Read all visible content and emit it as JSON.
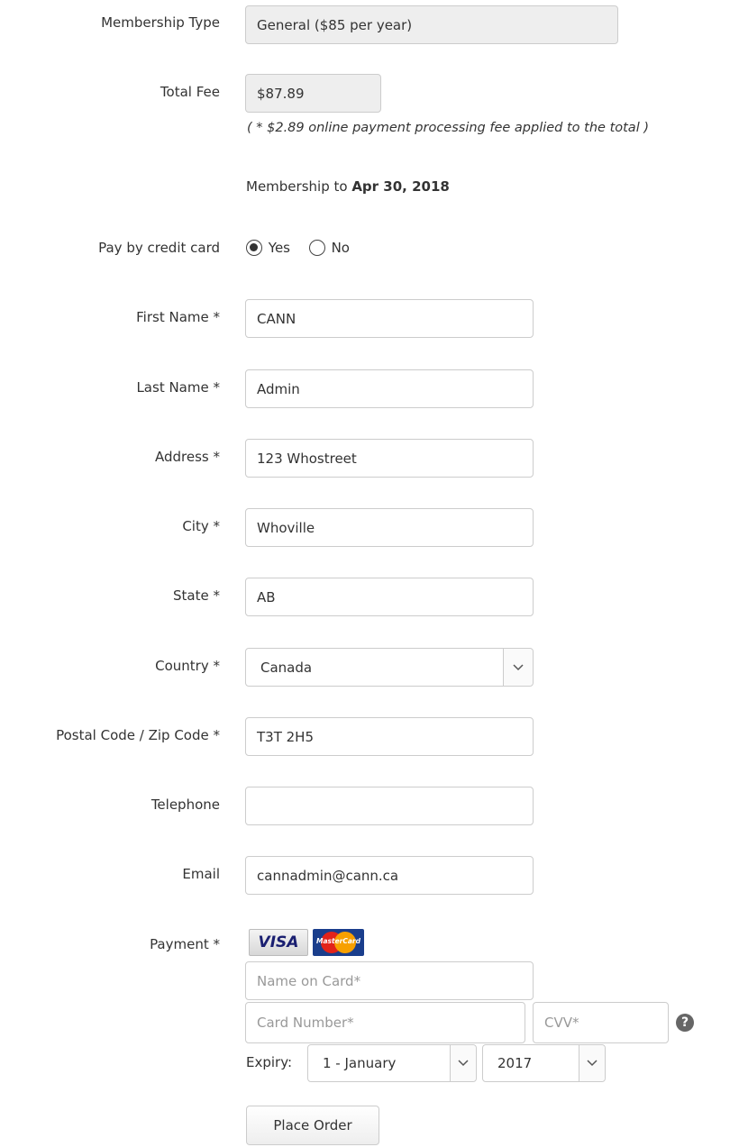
{
  "membership": {
    "type_label": "Membership Type",
    "type_value": "General ($85 per year)",
    "fee_label": "Total Fee",
    "fee_value": "$87.89",
    "fee_note": "( * $2.89 online payment processing fee applied to the total )",
    "expiry_prefix": "Membership to ",
    "expiry_date": "Apr 30, 2018"
  },
  "pay_by_card": {
    "label": "Pay by credit card",
    "yes": "Yes",
    "no": "No",
    "selected": "Yes"
  },
  "fields": {
    "first_name": {
      "label": "First Name *",
      "value": "CANN"
    },
    "last_name": {
      "label": "Last Name *",
      "value": "Admin"
    },
    "address": {
      "label": "Address *",
      "value": "123 Whostreet"
    },
    "city": {
      "label": "City *",
      "value": "Whoville"
    },
    "state": {
      "label": "State *",
      "value": "AB"
    },
    "country": {
      "label": "Country *",
      "value": "Canada"
    },
    "postal": {
      "label": "Postal Code / Zip Code *",
      "value": "T3T 2H5"
    },
    "telephone": {
      "label": "Telephone",
      "value": ""
    },
    "email": {
      "label": "Email",
      "value": "cannadmin@cann.ca"
    }
  },
  "payment": {
    "label": "Payment *",
    "visa_text": "VISA",
    "mastercard_text": "MasterCard",
    "name_placeholder": "Name on Card*",
    "number_placeholder": "Card Number*",
    "cvv_placeholder": "CVV*",
    "help_glyph": "?",
    "expiry_label": "Expiry:",
    "expiry_month": "1 - January",
    "expiry_year": "2017"
  },
  "submit_label": "Place Order"
}
